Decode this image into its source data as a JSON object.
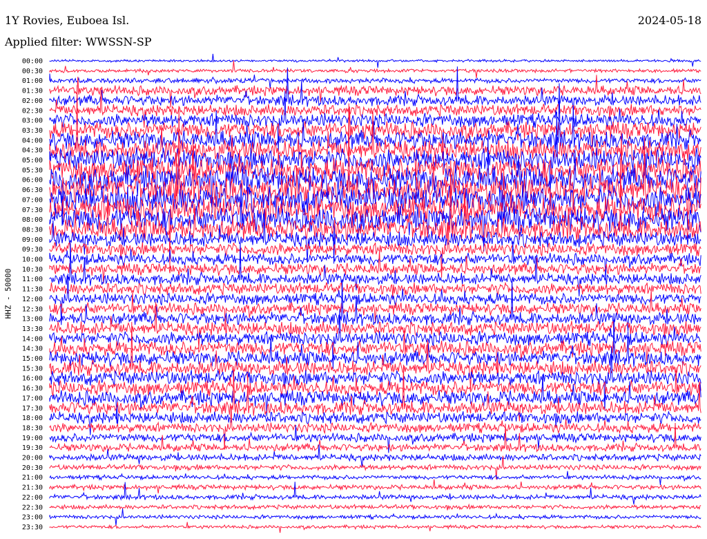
{
  "chart_data": {
    "type": "line",
    "title": "1Y Rovies, Euboea Isl.",
    "date": "2024-05-18",
    "filter_label": "Applied filter: WWSSN-SP",
    "ylabel": "HHZ - 50000",
    "row_labels": [
      "00:00",
      "00:30",
      "01:00",
      "01:30",
      "02:00",
      "02:30",
      "03:00",
      "03:30",
      "04:00",
      "04:30",
      "05:00",
      "05:30",
      "06:00",
      "06:30",
      "07:00",
      "07:30",
      "08:00",
      "08:30",
      "09:00",
      "09:30",
      "10:00",
      "10:30",
      "11:00",
      "11:30",
      "12:00",
      "12:30",
      "13:00",
      "13:30",
      "14:00",
      "14:30",
      "15:00",
      "15:30",
      "16:00",
      "16:30",
      "17:00",
      "17:30",
      "18:00",
      "18:30",
      "19:00",
      "19:30",
      "20:00",
      "20:30",
      "21:00",
      "21:30",
      "22:00",
      "22:30",
      "23:00",
      "23:30"
    ],
    "series_colors": [
      "#0000ff",
      "#ff1a3c"
    ],
    "relative_amplitude": [
      0.25,
      0.35,
      0.5,
      1.0,
      1.1,
      1.2,
      1.4,
      1.7,
      1.9,
      2.1,
      2.3,
      2.5,
      2.7,
      2.8,
      2.8,
      2.7,
      2.6,
      2.3,
      1.6,
      1.3,
      1.2,
      1.2,
      1.2,
      1.2,
      1.2,
      1.2,
      1.3,
      1.4,
      1.4,
      1.5,
      1.5,
      1.5,
      1.5,
      1.5,
      1.5,
      1.4,
      1.2,
      1.0,
      0.9,
      0.8,
      0.7,
      0.55,
      0.45,
      0.5,
      0.5,
      0.45,
      0.4,
      0.35
    ]
  }
}
